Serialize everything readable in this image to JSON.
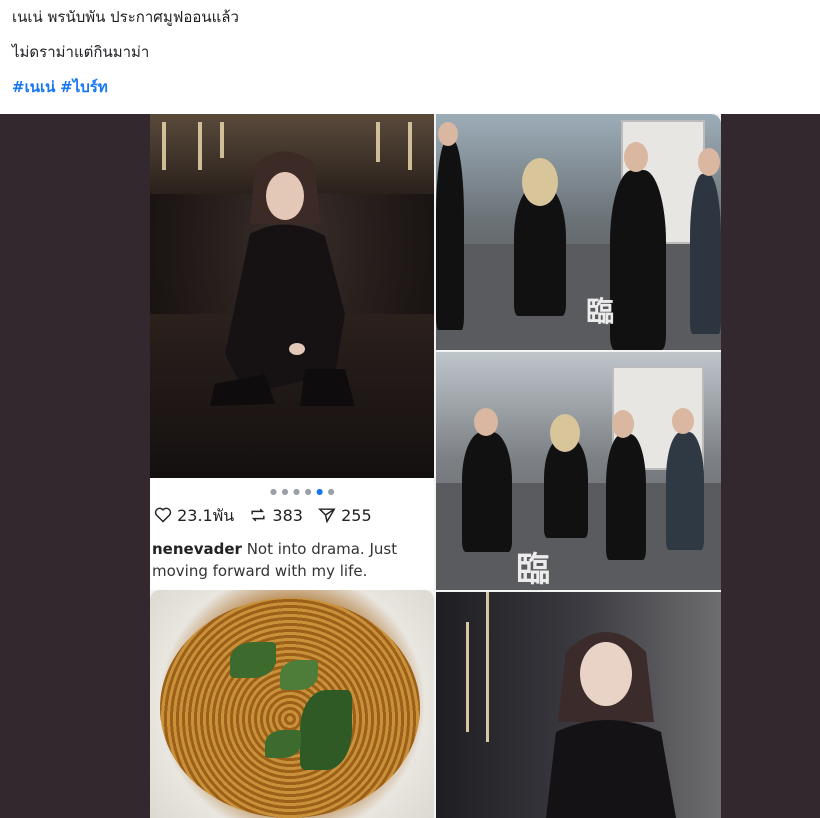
{
  "post": {
    "line1": "เนเน่ พรนับพัน ประกาศมูฟออนแล้ว",
    "line2": "ไม่ดราม่าแต่กินมาม่า",
    "hashtags": [
      "#เนเน่",
      "#ไบร์ท"
    ]
  },
  "instagram_overlay": {
    "likes": "23.1พัน",
    "reposts": "383",
    "shares": "255",
    "username": "nenevader",
    "caption": "Not into drama. Just moving forward with my life.",
    "carousel_dots": 6,
    "carousel_active": 5
  },
  "street_marking": "臨",
  "colors": {
    "hashtag": "#1877f2",
    "media_bg": "#34282f",
    "text": "#1c1e21"
  },
  "icons": [
    "heart-icon",
    "repost-icon",
    "send-icon"
  ]
}
